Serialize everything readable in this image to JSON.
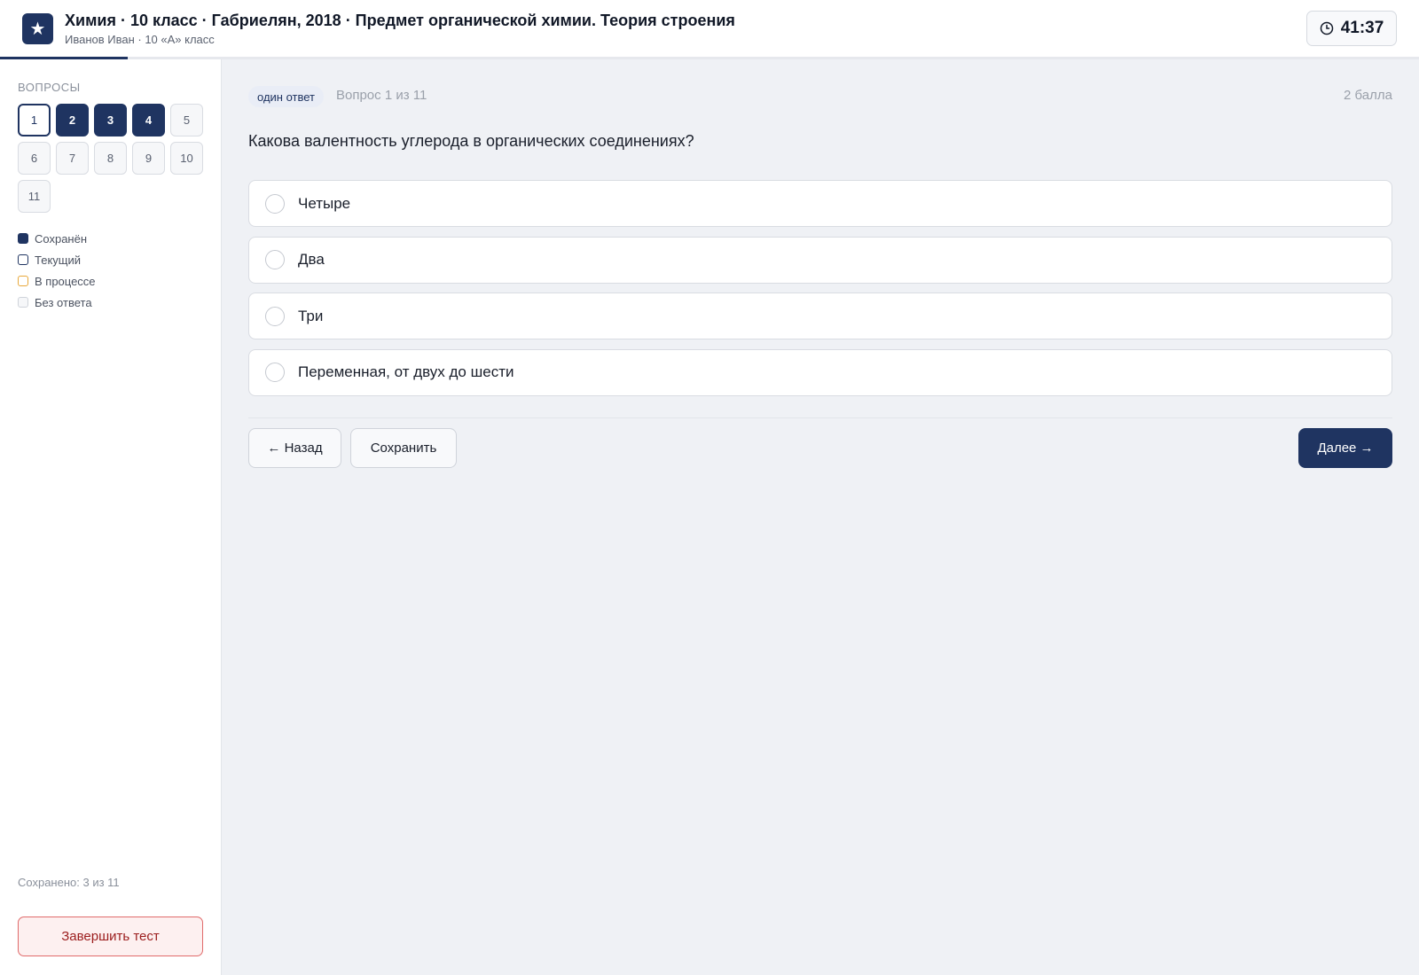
{
  "header": {
    "logo_icon": "star-icon",
    "title": "Химия · 10 класс · Габриелян, 2018 · Предмет органической химии. Теория строения",
    "subtitle": "Иванов Иван · 10 «А» класс",
    "timer": "41:37",
    "timer_icon": "clock-icon",
    "progress_fraction": 0.09
  },
  "sidebar": {
    "heading": "ВОПРОСЫ",
    "questions": [
      {
        "label": "1",
        "state": "current"
      },
      {
        "label": "2",
        "state": "saved"
      },
      {
        "label": "3",
        "state": "saved"
      },
      {
        "label": "4",
        "state": "saved"
      },
      {
        "label": "5",
        "state": "empty"
      },
      {
        "label": "6",
        "state": "empty"
      },
      {
        "label": "7",
        "state": "empty"
      },
      {
        "label": "8",
        "state": "empty"
      },
      {
        "label": "9",
        "state": "empty"
      },
      {
        "label": "10",
        "state": "empty"
      },
      {
        "label": "11",
        "state": "empty"
      }
    ],
    "legend": [
      {
        "key": "saved",
        "label": "Сохранён"
      },
      {
        "key": "current",
        "label": "Текущий"
      },
      {
        "key": "progress",
        "label": "В процессе"
      },
      {
        "key": "empty",
        "label": "Без ответа"
      }
    ],
    "saved_count": "Сохранено: 3 из 11",
    "finish_label": "Завершить тест"
  },
  "main": {
    "badge": "один ответ",
    "question_number": "Вопрос 1 из 11",
    "points": "2 балла",
    "question": "Какова валентность углерода в органических соединениях?",
    "options": [
      "Четыре",
      "Два",
      "Три",
      "Переменная, от двух до шести"
    ],
    "back_label": "← Назад",
    "save_label": "Сохранить",
    "next_label": "Далее →"
  },
  "colors": {
    "primary": "#1f3461",
    "in_progress": "#e8a83a",
    "danger": "#e06a6a",
    "background": "#eff1f5"
  }
}
